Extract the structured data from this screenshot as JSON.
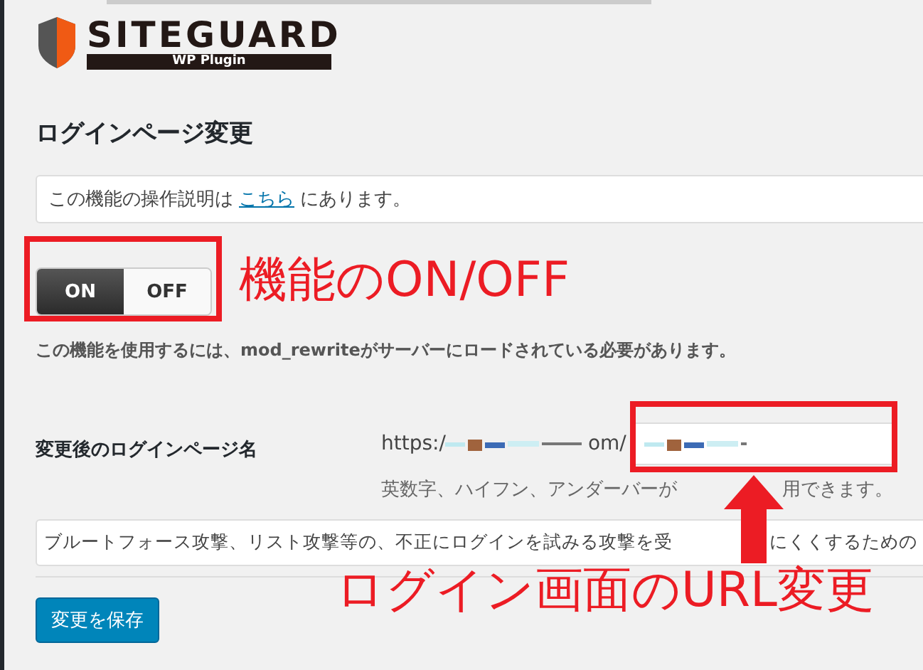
{
  "logo": {
    "name": "SITEGUARD",
    "subtitle": "WP Plugin"
  },
  "heading": "ログインページ変更",
  "info": {
    "before": "この機能の操作説明は",
    "link": "こちら",
    "after": "にあります。"
  },
  "toggle": [
    {
      "label": "ON",
      "selected": true
    },
    {
      "label": "OFF",
      "selected": false
    }
  ],
  "note": "この機能を使用するには、mod_rewriteがサーバーにロードされている必要があります。",
  "setting": {
    "label": "変更後のログインページ名",
    "url_start": "https:/",
    "url_end": "om/",
    "hint_start": "英数字、ハイフン、アンダーバーが",
    "hint_end": "用できます。"
  },
  "description": {
    "start": "ブルートフォース攻撃、リスト攻撃等の、不正にログインを試みる攻撃を受",
    "end": "にくくするための"
  },
  "save_button": "変更を保存",
  "annotations": [
    {
      "text": "機能のON/OFF"
    },
    {
      "text": "ログイン画面のURL変更"
    }
  ]
}
